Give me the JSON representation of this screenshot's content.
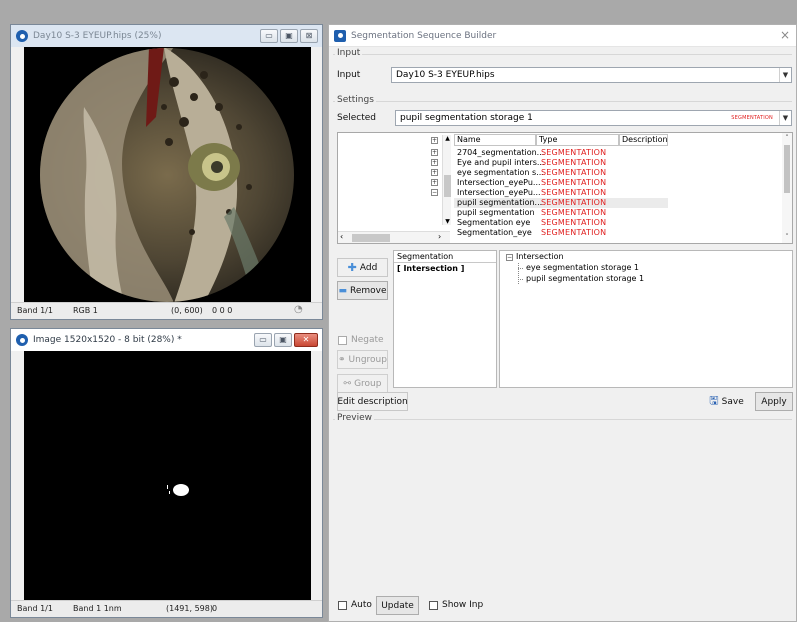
{
  "top_window": {
    "title": "Day10 S-3 EYEUP.hips (25%)",
    "status": {
      "band": "Band 1/1",
      "mode": "RGB 1",
      "coords": "(0, 600)",
      "values": "0 0 0"
    }
  },
  "bottom_window": {
    "title": "Image 1520x1520 - 8 bit (28%) *",
    "status": {
      "band": "Band 1/1",
      "mode": "Band 1 1nm",
      "coords": "(1491, 598)",
      "values": "0"
    }
  },
  "builder": {
    "title": "Segmentation Sequence Builder",
    "close_glyph": "×",
    "input_group": "Input",
    "input_label": "Input",
    "input_value": "Day10 S-3 EYEUP.hips",
    "settings_group": "Settings",
    "selected_label": "Selected",
    "selected_value": "pupil segmentation storage 1",
    "selected_tag": "SEGMENTATION",
    "columns": [
      "Name",
      "Type",
      "Description"
    ],
    "rows": [
      {
        "name": "2704_segmentation...",
        "type": "SEGMENTATION"
      },
      {
        "name": "Eye and pupil inters...",
        "type": "SEGMENTATION"
      },
      {
        "name": "eye segmentation s...",
        "type": "SEGMENTATION"
      },
      {
        "name": "Intersection_eyePu...",
        "type": "SEGMENTATION"
      },
      {
        "name": "Intersection_eyePu...",
        "type": "SEGMENTATION"
      },
      {
        "name": "pupil segmentation...",
        "type": "SEGMENTATION"
      },
      {
        "name": "pupil segmentation",
        "type": "SEGMENTATION"
      },
      {
        "name": "Segmentation eye",
        "type": "SEGMENTATION"
      },
      {
        "name": "Segmentation_eye",
        "type": "SEGMENTATION"
      }
    ],
    "add_label": "Add",
    "remove_label": "Remove",
    "negate_label": "Negate",
    "ungroup_label": "Ungroup",
    "group_label": "Group",
    "segmentation_header": "Segmentation",
    "segmentation_item": "[ Intersection ]",
    "tree_root": "Intersection",
    "tree_children": [
      "eye segmentation storage 1",
      "pupil segmentation storage 1"
    ],
    "edit_description_label": "Edit description",
    "save_label": "Save",
    "apply_label": "Apply",
    "preview_group": "Preview",
    "auto_label": "Auto",
    "update_label": "Update",
    "show_inp_label": "Show Inp"
  }
}
